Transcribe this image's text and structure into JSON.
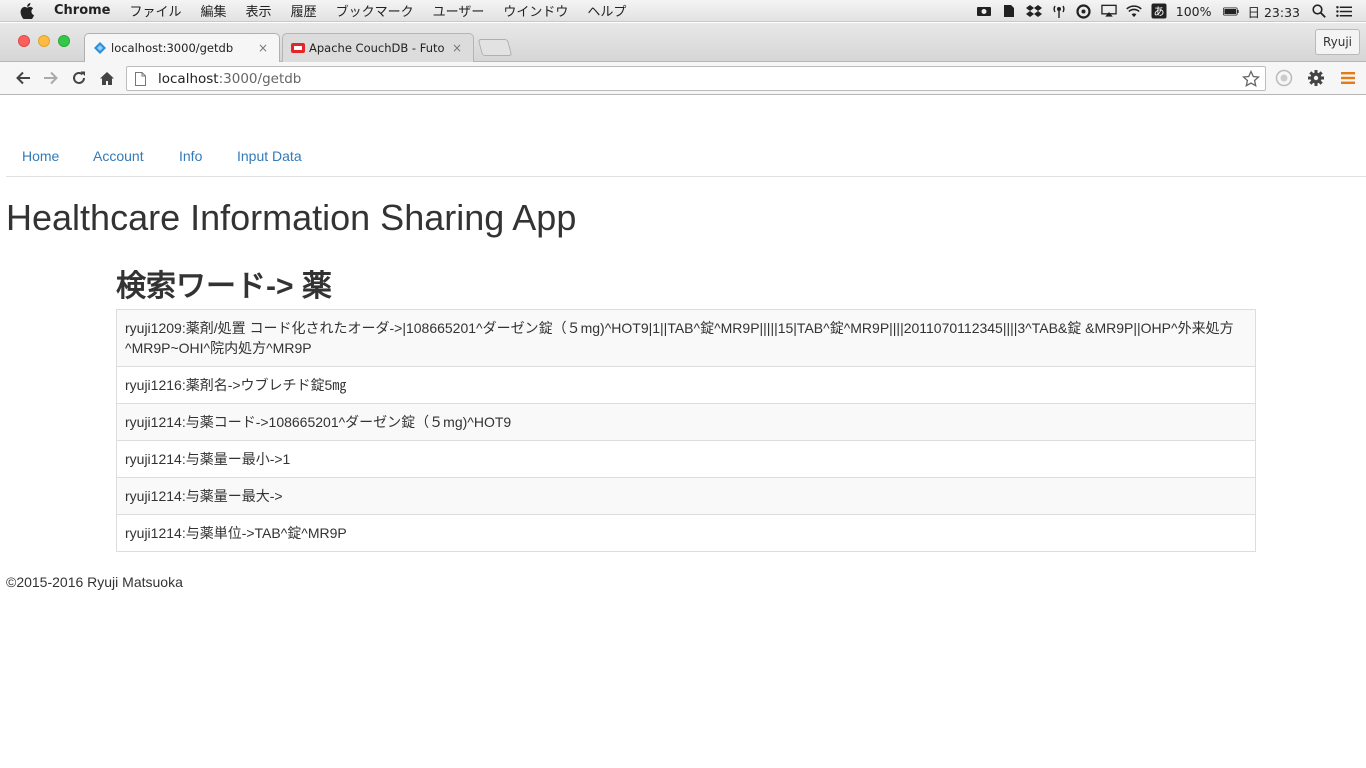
{
  "menubar": {
    "app_name": "Chrome",
    "items": [
      "ファイル",
      "編集",
      "表示",
      "履歴",
      "ブックマーク",
      "ユーザー",
      "ウインドウ",
      "ヘルプ"
    ],
    "battery": "100%",
    "clock": "日 23:33"
  },
  "browser": {
    "tabs": [
      {
        "title": "localhost:3000/getdb",
        "close": "×"
      },
      {
        "title": "Apache CouchDB - Futon:",
        "close": "×"
      }
    ],
    "profile": "Ryuji",
    "address": {
      "host": "localhost",
      "path": ":3000/getdb"
    }
  },
  "nav": {
    "items": [
      "Home",
      "Account",
      "Info",
      "Input Data"
    ]
  },
  "page": {
    "title": "Healthcare Information Sharing App",
    "search_label": "検索ワード",
    "search_arrow": "->",
    "search_word": "薬",
    "results": [
      "ryuji1209:薬剤/処置 コード化されたオーダ->|108665201^ダーゼン錠（５mg)^HOT9|1||TAB^錠^MR9P|||||15|TAB^錠^MR9P||||2011070112345||||3^TAB&錠 &MR9P||OHP^外来処方^MR9P~OHI^院内処方^MR9P",
      "ryuji1216:薬剤名->ウブレチド錠5㎎",
      "ryuji1214:与薬コード->108665201^ダーゼン錠（５mg)^HOT9",
      "ryuji1214:与薬量ー最小->1",
      "ryuji1214:与薬量ー最大->",
      "ryuji1214:与薬単位->TAB^錠^MR9P"
    ],
    "footer": "©2015-2016 Ryuji Matsuoka"
  },
  "colors": {
    "link": "#337ab7",
    "text": "#333333",
    "stripe": "#f9f9f9",
    "border": "#dddddd"
  }
}
